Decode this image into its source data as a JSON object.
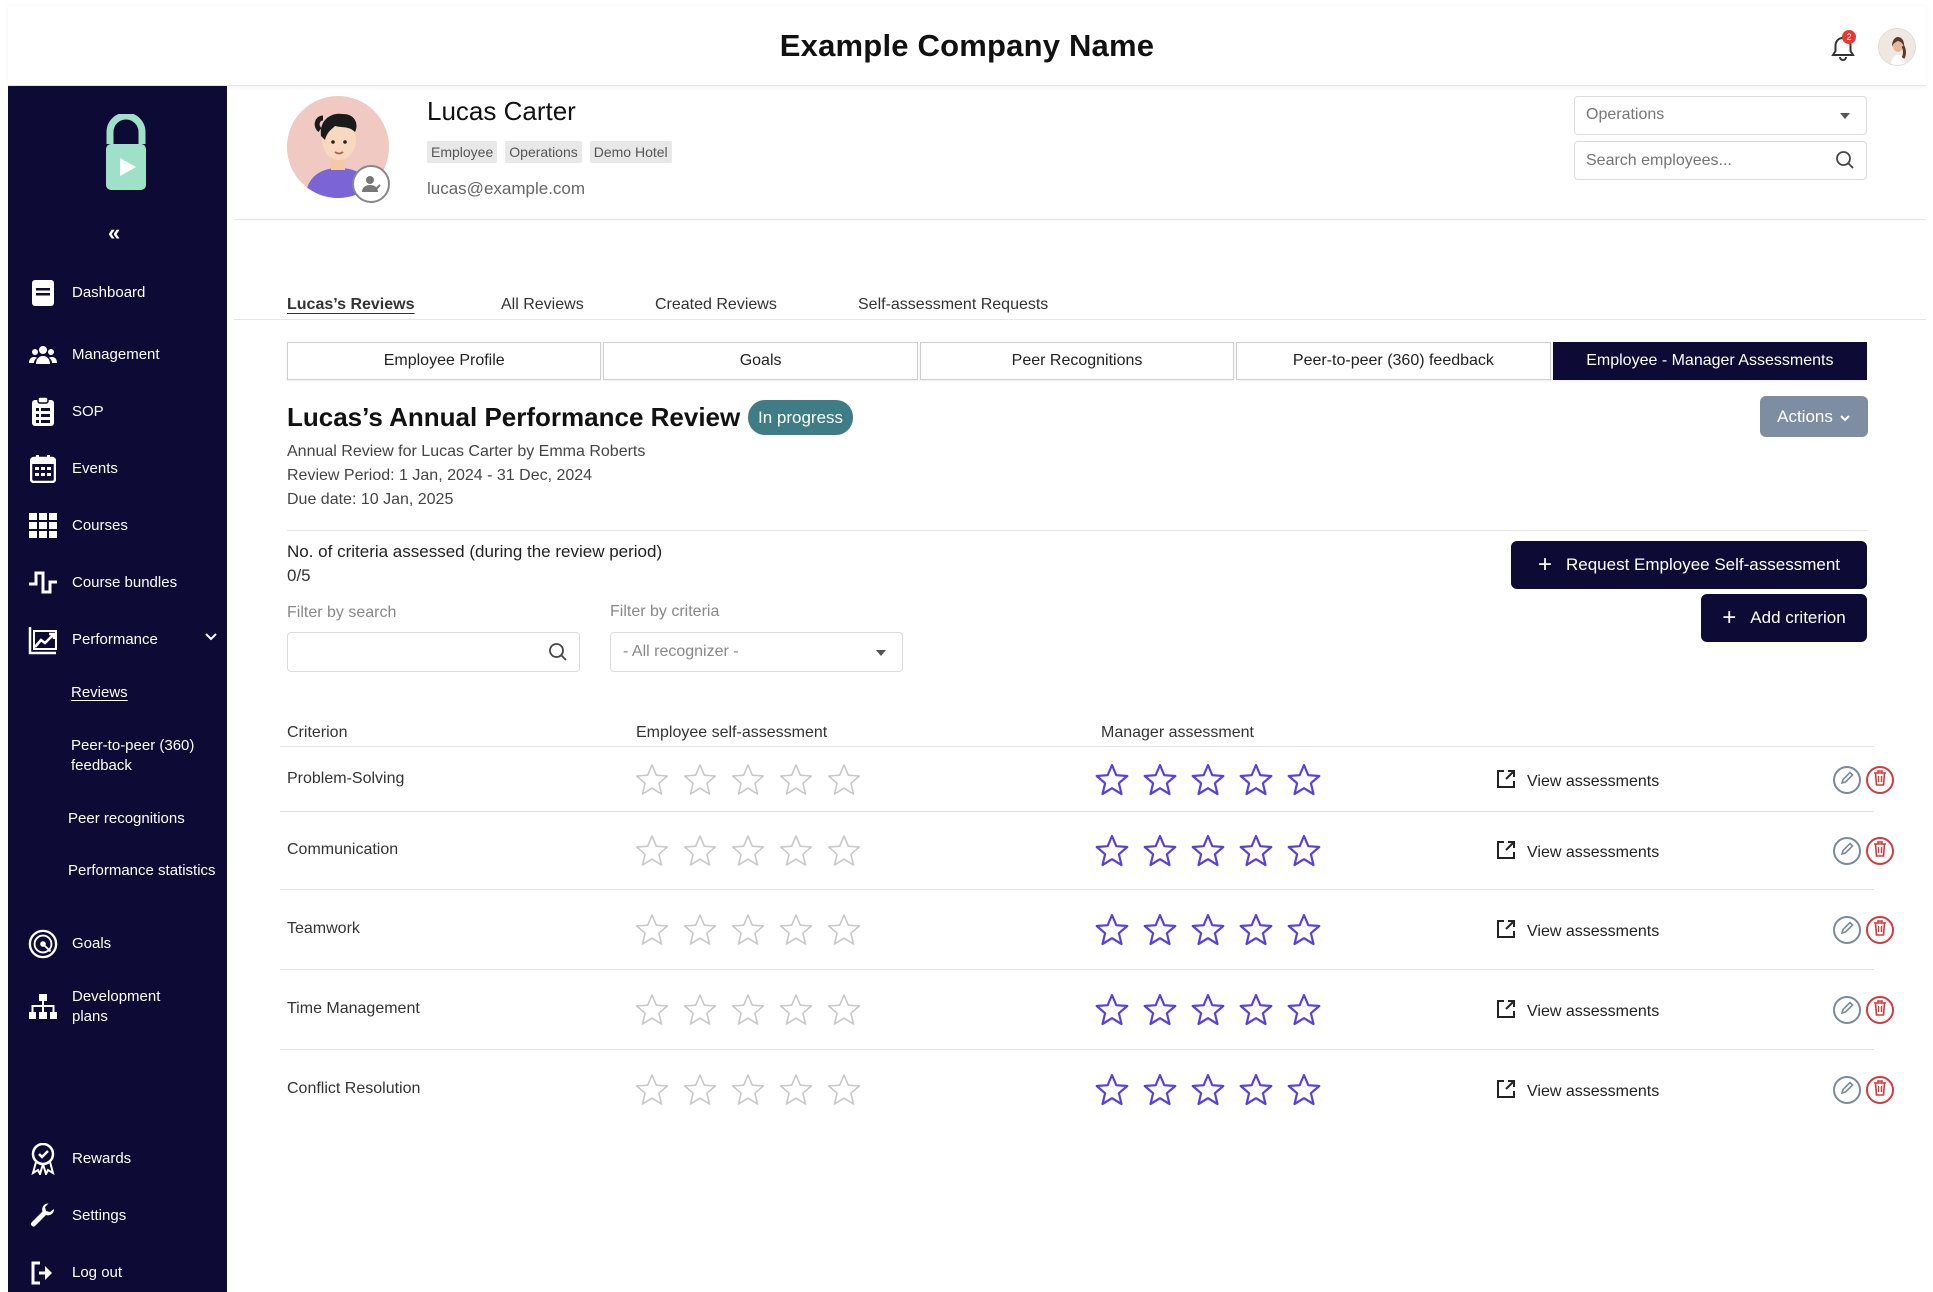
{
  "header": {
    "company_name": "Example Company Name",
    "notification_count": "2"
  },
  "sidebar": {
    "collapse_glyph": "«",
    "items": [
      {
        "label": "Dashboard",
        "icon": "dashboard-icon"
      },
      {
        "label": "Management",
        "icon": "people-icon"
      },
      {
        "label": "SOP",
        "icon": "clipboard-icon"
      },
      {
        "label": "Events",
        "icon": "calendar-icon"
      },
      {
        "label": "Courses",
        "icon": "grid-icon"
      },
      {
        "label": "Course bundles",
        "icon": "bundle-icon"
      },
      {
        "label": "Performance",
        "icon": "chart-icon"
      },
      {
        "label": "Goals",
        "icon": "target-icon"
      },
      {
        "label": "Development plans",
        "icon": "hierarchy-icon"
      },
      {
        "label": "Rewards",
        "icon": "award-icon"
      },
      {
        "label": "Settings",
        "icon": "wrench-icon"
      },
      {
        "label": "Log out",
        "icon": "logout-icon"
      }
    ],
    "performance_sub": [
      {
        "label": "Reviews",
        "active": true
      },
      {
        "label": "Peer-to-peer (360) feedback"
      },
      {
        "label": "Peer recognitions"
      },
      {
        "label": "Performance statistics"
      }
    ]
  },
  "profile": {
    "name": "Lucas Carter",
    "tags": [
      "Employee",
      "Operations",
      "Demo Hotel"
    ],
    "email": "lucas@example.com"
  },
  "filters_top": {
    "department": "Operations",
    "search_placeholder": "Search employees..."
  },
  "review_tabs": [
    "Lucas’s Reviews",
    "All Reviews",
    "Created Reviews",
    "Self-assessment Requests"
  ],
  "section_tabs": [
    "Employee Profile",
    "Goals",
    "Peer Recognitions",
    "Peer-to-peer (360) feedback",
    "Employee - Manager Assessments"
  ],
  "review": {
    "title": "Lucas’s Annual Performance Review",
    "status": "In progress",
    "actions_label": "Actions",
    "subtitle": "Annual Review for Lucas Carter by Emma Roberts",
    "period": "Review Period: 1 Jan, 2024 - 31 Dec, 2024",
    "due": "Due date: 10 Jan, 2025",
    "criteria_label": "No. of criteria assessed (during the review period)",
    "criteria_count": "0/5",
    "request_btn": "Request Employee Self-assessment",
    "add_btn": "Add criterion"
  },
  "filters": {
    "search_label": "Filter by search",
    "criteria_label": "Filter by criteria",
    "criteria_value": "- All recognizer -"
  },
  "table": {
    "headers": [
      "Criterion",
      "Employee self-assessment",
      "Manager assessment"
    ],
    "view_label": "View assessments",
    "rows": [
      {
        "name": "Problem-Solving",
        "self_rating": 0,
        "manager_rating": 0
      },
      {
        "name": "Communication",
        "self_rating": 0,
        "manager_rating": 0
      },
      {
        "name": "Teamwork",
        "self_rating": 0,
        "manager_rating": 0
      },
      {
        "name": "Time Management",
        "self_rating": 0,
        "manager_rating": 0
      },
      {
        "name": "Conflict Resolution",
        "self_rating": 0,
        "manager_rating": 0
      }
    ],
    "max_stars": 5
  },
  "colors": {
    "sidebar_bg": "#0d0a35",
    "status_pill": "#3f7d86",
    "manager_star": "#5b3fd9",
    "self_star": "#c8c8c8",
    "delete_red": "#d23b3b",
    "logo_mint": "#9ee0c8"
  }
}
